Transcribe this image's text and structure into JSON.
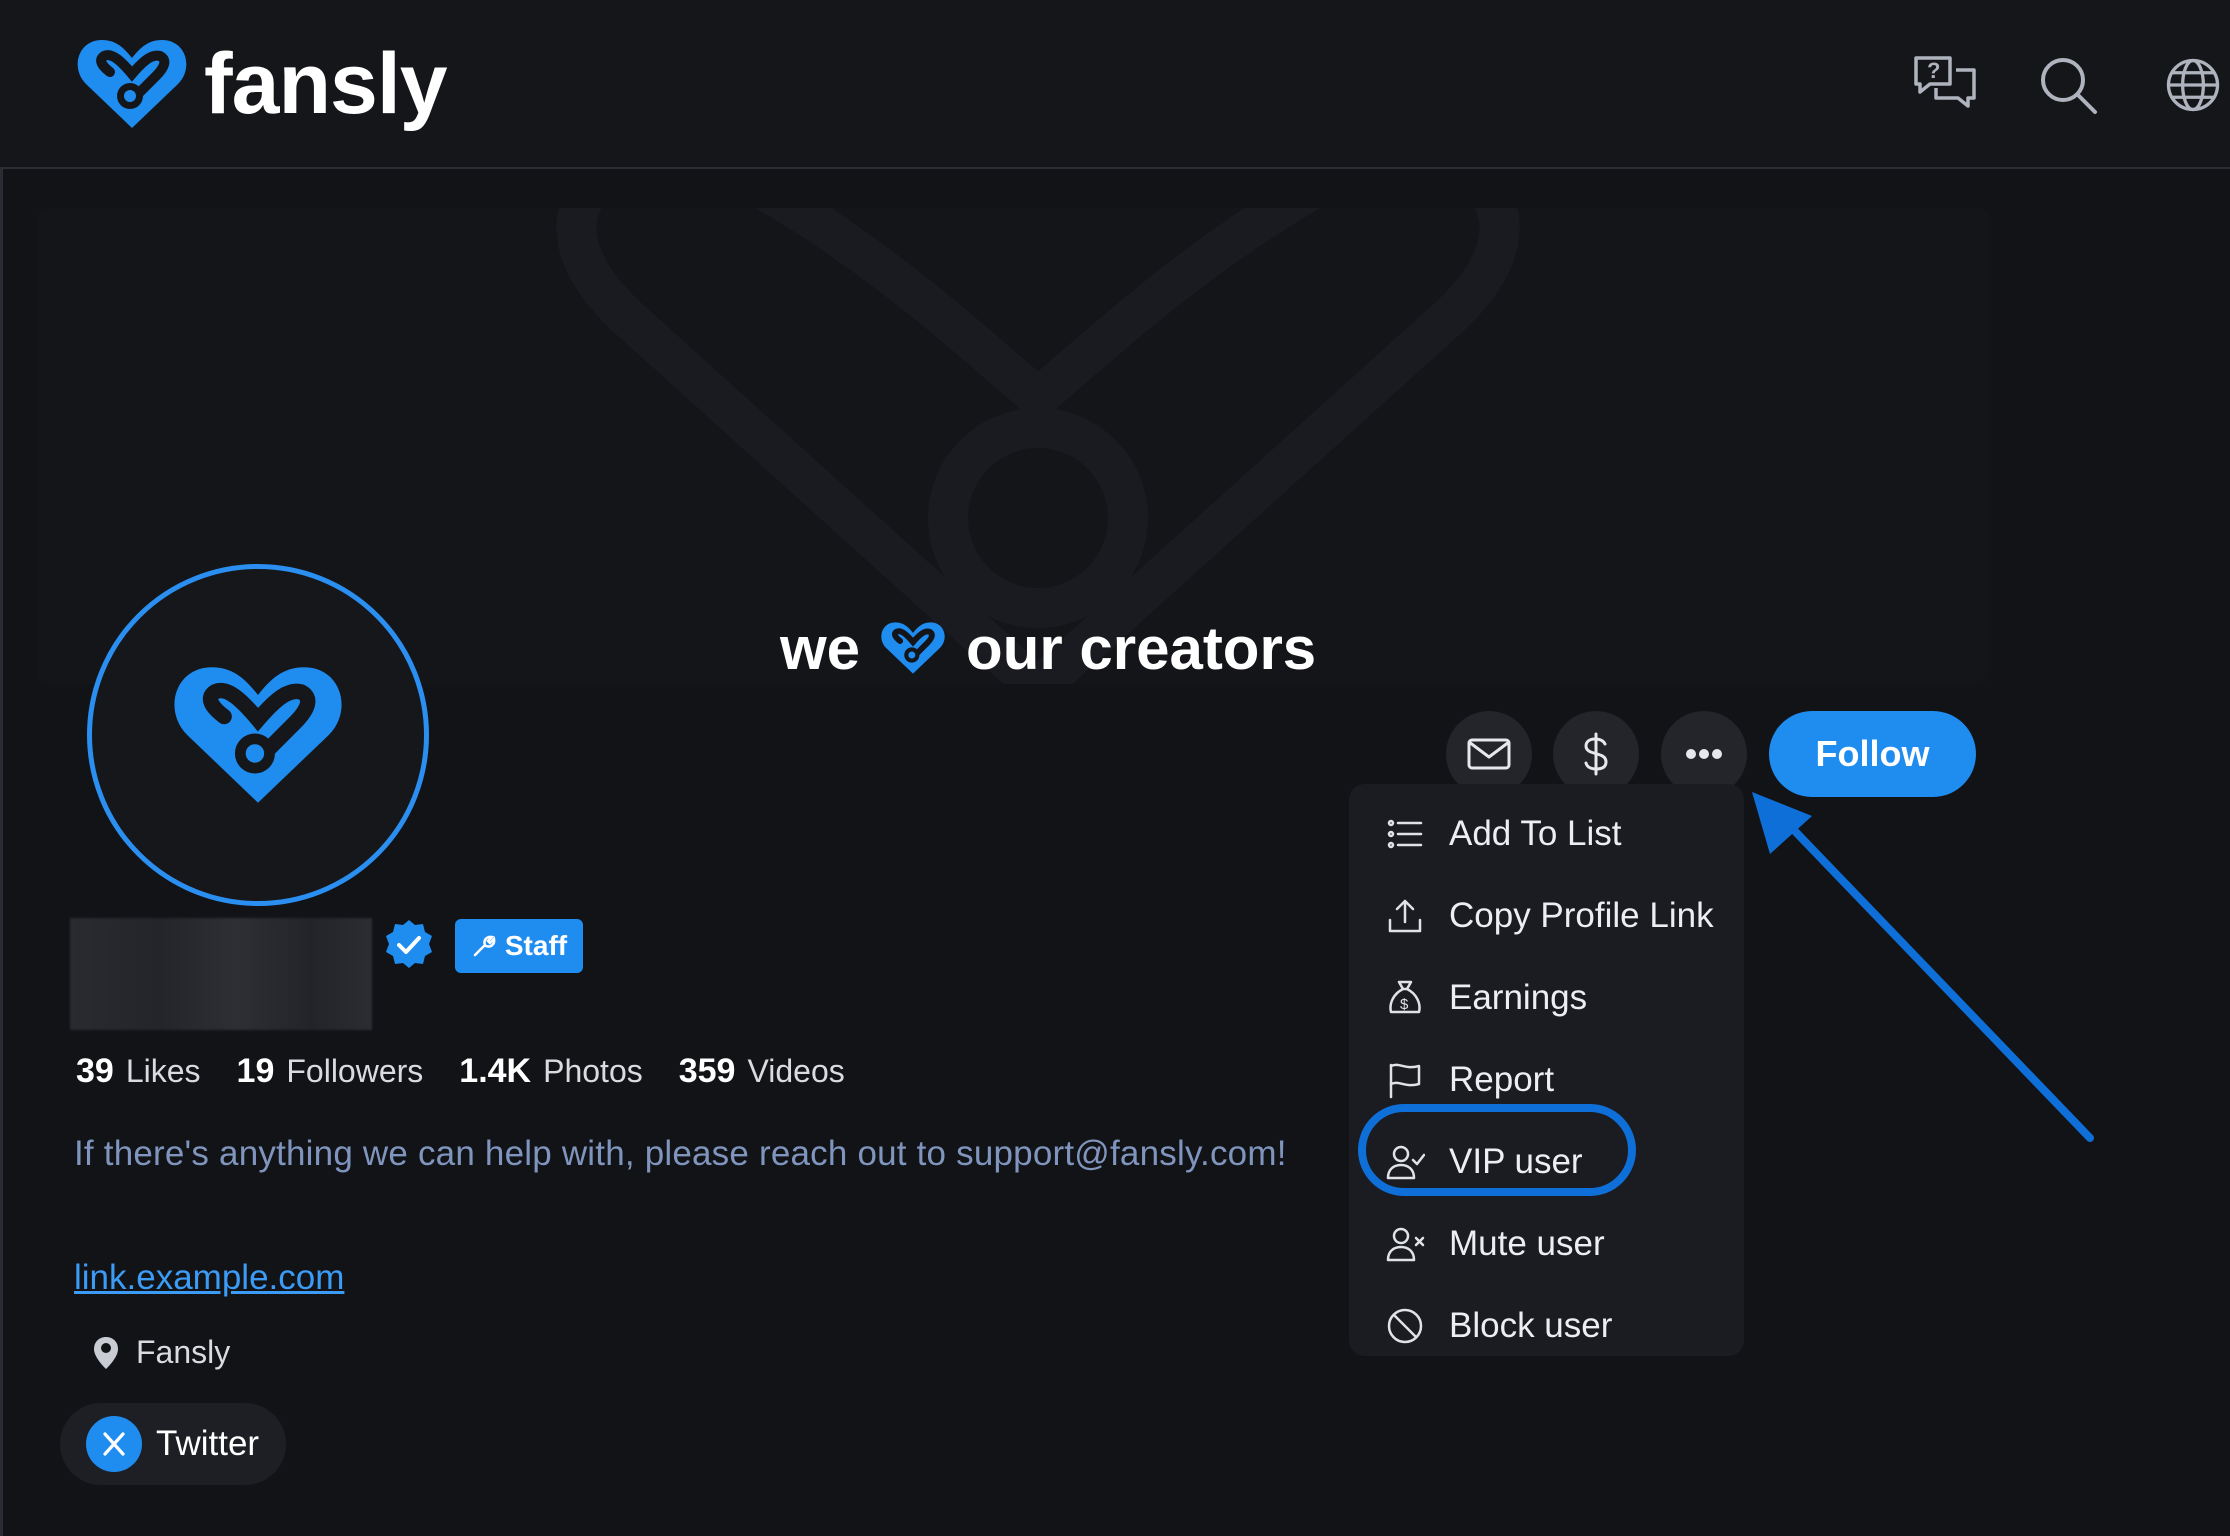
{
  "app": {
    "brand": "fansly",
    "accent_color": "#1f8cf0"
  },
  "header": {
    "icons": [
      "chat-help-icon",
      "search-icon",
      "globe-icon"
    ]
  },
  "banner": {
    "tagline_before": "we",
    "tagline_after": "our creators"
  },
  "profile": {
    "badge_label": "Staff",
    "stats": [
      {
        "value": "39",
        "label": "Likes"
      },
      {
        "value": "19",
        "label": "Followers"
      },
      {
        "value": "1.4K",
        "label": "Photos"
      },
      {
        "value": "359",
        "label": "Videos"
      }
    ],
    "bio": "If there's anything we can help with, please reach out to support@fansly.com!",
    "link": "link.example.com",
    "location": "Fansly",
    "social_label": "Twitter"
  },
  "actions": {
    "follow_label": "Follow"
  },
  "menu": {
    "items": [
      {
        "label": "Add To List",
        "icon": "list-icon"
      },
      {
        "label": "Copy Profile Link",
        "icon": "upload-icon"
      },
      {
        "label": "Earnings",
        "icon": "money-bag-icon"
      },
      {
        "label": "Report",
        "icon": "flag-icon"
      },
      {
        "label": "VIP user",
        "icon": "user-check-icon"
      },
      {
        "label": "Mute user",
        "icon": "user-x-icon"
      },
      {
        "label": "Block user",
        "icon": "block-icon"
      }
    ],
    "highlighted": "VIP user"
  }
}
